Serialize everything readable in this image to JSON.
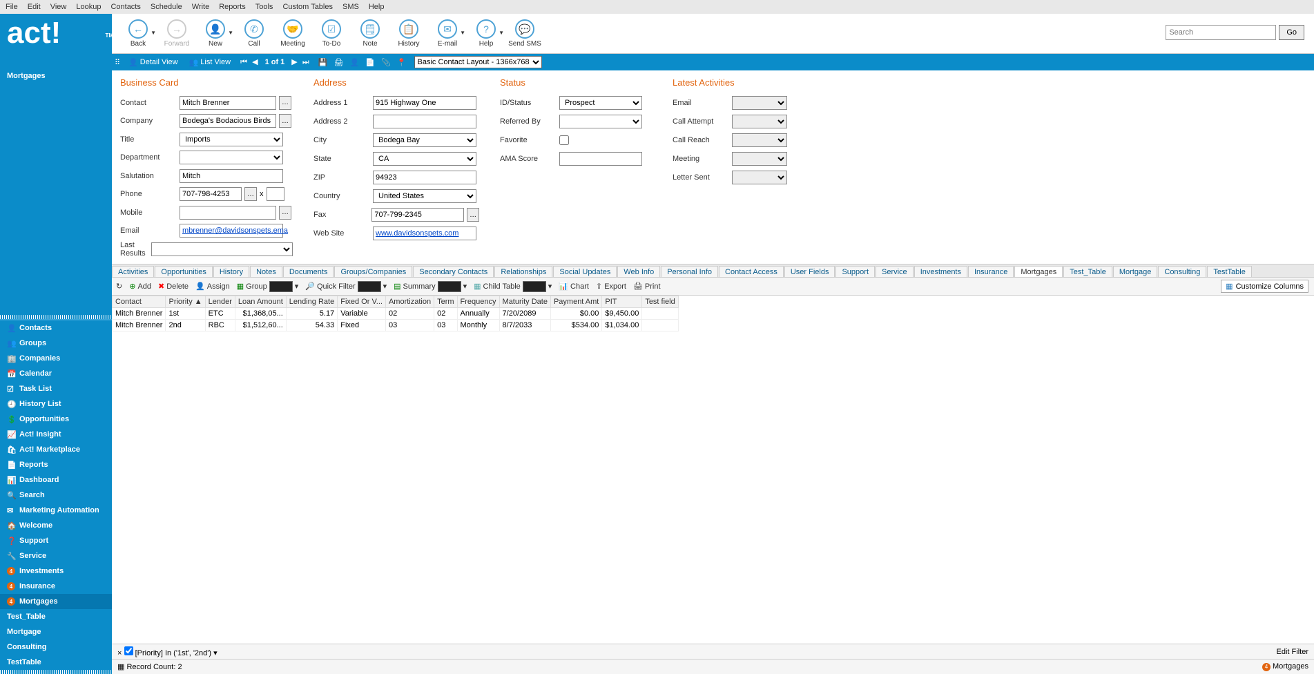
{
  "menubar": [
    "File",
    "Edit",
    "View",
    "Lookup",
    "Contacts",
    "Schedule",
    "Write",
    "Reports",
    "Tools",
    "Custom Tables",
    "SMS",
    "Help"
  ],
  "logo": {
    "text": "act!",
    "tm": "TM",
    "subtitle": "Mortgages"
  },
  "toolbar": [
    {
      "label": "Back",
      "icon": "←",
      "dd": true
    },
    {
      "label": "Forward",
      "icon": "→",
      "disabled": true
    },
    {
      "label": "New",
      "icon": "👤",
      "dd": true
    },
    {
      "label": "Call",
      "icon": "✆"
    },
    {
      "label": "Meeting",
      "icon": "🤝"
    },
    {
      "label": "To-Do",
      "icon": "☑"
    },
    {
      "label": "Note",
      "icon": "🗒"
    },
    {
      "label": "History",
      "icon": "📋"
    },
    {
      "label": "E-mail",
      "icon": "✉",
      "dd": true
    },
    {
      "label": "Help",
      "icon": "?",
      "dd": true
    },
    {
      "label": "Send SMS",
      "icon": "💬"
    }
  ],
  "search": {
    "placeholder": "Search",
    "go": "Go"
  },
  "blueBar": {
    "detailView": "Detail View",
    "listView": "List View",
    "position": "1 of 1",
    "layoutSelect": "Basic Contact Layout - 1366x768"
  },
  "sections": {
    "businessCard": "Business Card",
    "address": "Address",
    "status": "Status",
    "latest": "Latest Activities"
  },
  "fields": {
    "contact": {
      "label": "Contact",
      "value": "Mitch Brenner"
    },
    "company": {
      "label": "Company",
      "value": "Bodega's Bodacious Birds"
    },
    "title": {
      "label": "Title",
      "value": "Imports"
    },
    "department": {
      "label": "Department",
      "value": ""
    },
    "salutation": {
      "label": "Salutation",
      "value": "Mitch"
    },
    "phone": {
      "label": "Phone",
      "value": "707-798-4253",
      "x": "x"
    },
    "mobile": {
      "label": "Mobile",
      "value": ""
    },
    "email": {
      "label": "Email",
      "value": "mbrenner@davidsonspets.ema"
    },
    "lastResults": {
      "label": "Last Results",
      "value": ""
    },
    "address1": {
      "label": "Address 1",
      "value": "915 Highway One"
    },
    "address2": {
      "label": "Address 2",
      "value": ""
    },
    "city": {
      "label": "City",
      "value": "Bodega Bay"
    },
    "state": {
      "label": "State",
      "value": "CA"
    },
    "zip": {
      "label": "ZIP",
      "value": "94923"
    },
    "country": {
      "label": "Country",
      "value": "United States"
    },
    "fax": {
      "label": "Fax",
      "value": "707-799-2345"
    },
    "website": {
      "label": "Web Site",
      "value": "www.davidsonspets.com"
    },
    "idStatus": {
      "label": "ID/Status",
      "value": "Prospect"
    },
    "referredBy": {
      "label": "Referred By",
      "value": ""
    },
    "favorite": {
      "label": "Favorite"
    },
    "amaScore": {
      "label": "AMA Score",
      "value": ""
    },
    "laEmail": {
      "label": "Email"
    },
    "laCallAttempt": {
      "label": "Call Attempt"
    },
    "laCallReach": {
      "label": "Call Reach"
    },
    "laMeeting": {
      "label": "Meeting"
    },
    "laLetter": {
      "label": "Letter Sent"
    }
  },
  "sidebar": {
    "items": [
      {
        "label": "Contacts",
        "icon": "👤"
      },
      {
        "label": "Groups",
        "icon": "👥"
      },
      {
        "label": "Companies",
        "icon": "🏢"
      },
      {
        "label": "Calendar",
        "icon": "📅"
      },
      {
        "label": "Task List",
        "icon": "☑"
      },
      {
        "label": "History List",
        "icon": "🕘"
      },
      {
        "label": "Opportunities",
        "icon": "💲"
      },
      {
        "label": "Act! Insight",
        "icon": "📈"
      },
      {
        "label": "Act! Marketplace",
        "icon": "🛍"
      },
      {
        "label": "Reports",
        "icon": "📄"
      },
      {
        "label": "Dashboard",
        "icon": "📊"
      },
      {
        "label": "Search",
        "icon": "🔍"
      },
      {
        "label": "Marketing Automation",
        "icon": "✉"
      },
      {
        "label": "Welcome",
        "icon": "🏠"
      },
      {
        "label": "Support",
        "icon": "❓"
      },
      {
        "label": "Service",
        "icon": "🔧"
      },
      {
        "label": "Investments",
        "badge": "4"
      },
      {
        "label": "Insurance",
        "badge": "4"
      },
      {
        "label": "Mortgages",
        "badge": "4",
        "active": true
      },
      {
        "label": "Test_Table"
      },
      {
        "label": "Mortgage"
      },
      {
        "label": "Consulting"
      },
      {
        "label": "TestTable"
      }
    ]
  },
  "tabs": [
    "Activities",
    "Opportunities",
    "History",
    "Notes",
    "Documents",
    "Groups/Companies",
    "Secondary Contacts",
    "Relationships",
    "Social Updates",
    "Web Info",
    "Personal Info",
    "Contact Access",
    "User Fields",
    "Support",
    "Service",
    "Investments",
    "Insurance",
    "Mortgages",
    "Test_Table",
    "Mortgage",
    "Consulting",
    "TestTable"
  ],
  "activeTab": "Mortgages",
  "subToolbar": {
    "refresh": "↻",
    "add": "Add",
    "delete": "Delete",
    "assign": "Assign",
    "group": "Group",
    "quickFilter": "Quick Filter",
    "summary": "Summary",
    "childTable": "Child Table",
    "chart": "Chart",
    "export": "Export",
    "print": "Print",
    "custCols": "Customize Columns"
  },
  "table": {
    "columns": [
      "Contact",
      "Priority  ▲",
      "Lender",
      "Loan Amount",
      "Lending Rate",
      "Fixed Or V...",
      "Amortization",
      "Term",
      "Frequency",
      "Maturity Date",
      "Payment Amt",
      "PIT",
      "Test field"
    ],
    "rows": [
      {
        "Contact": "Mitch Brenner",
        "Priority": "1st",
        "Lender": "ETC",
        "LoanAmount": "$1,368,05...",
        "LendingRate": "5.17",
        "Fixed": "Variable",
        "Amort": "02",
        "Term": "02",
        "Freq": "Annually",
        "Maturity": "7/20/2089",
        "Payment": "$0.00",
        "PIT": "$9,450.00",
        "Test": ""
      },
      {
        "Contact": "Mitch Brenner",
        "Priority": "2nd",
        "Lender": "RBC",
        "LoanAmount": "$1,512,60...",
        "LendingRate": "54.33",
        "Fixed": "Fixed",
        "Amort": "03",
        "Term": "03",
        "Freq": "Monthly",
        "Maturity": "8/7/2033",
        "Payment": "$534.00",
        "PIT": "$1,034.00",
        "Test": ""
      }
    ]
  },
  "filterBar": {
    "text": "[Priority] In ('1st', '2nd')",
    "edit": "Edit Filter",
    "close": "×"
  },
  "statusBar": {
    "count": "Record Count: 2",
    "right": "Mortgages",
    "badge": "4"
  }
}
